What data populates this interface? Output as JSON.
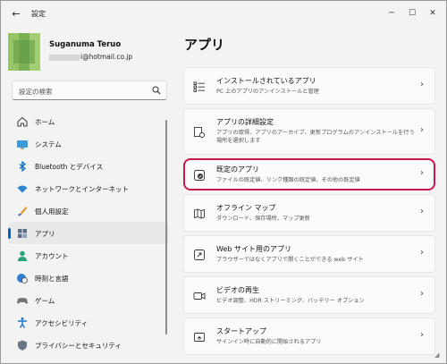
{
  "window": {
    "title": "設定",
    "back_icon": "back-arrow-icon",
    "min_glyph": "─",
    "max_glyph": "☐",
    "close_glyph": "✕"
  },
  "profile": {
    "name": "Suganuma Teruo",
    "email": "i@hotmail.co.jp"
  },
  "search": {
    "placeholder": "設定の検索"
  },
  "sidebar": {
    "items": [
      {
        "label": "ホーム",
        "icon": "home-icon"
      },
      {
        "label": "システム",
        "icon": "system-icon"
      },
      {
        "label": "Bluetooth とデバイス",
        "icon": "bluetooth-icon"
      },
      {
        "label": "ネットワークとインターネット",
        "icon": "wifi-icon"
      },
      {
        "label": "個人用設定",
        "icon": "brush-icon"
      },
      {
        "label": "アプリ",
        "icon": "apps-icon",
        "active": true
      },
      {
        "label": "アカウント",
        "icon": "account-icon"
      },
      {
        "label": "時刻と言語",
        "icon": "time-language-icon"
      },
      {
        "label": "ゲーム",
        "icon": "gamepad-icon"
      },
      {
        "label": "アクセシビリティ",
        "icon": "accessibility-icon"
      },
      {
        "label": "プライバシーとセキュリティ",
        "icon": "shield-icon"
      }
    ]
  },
  "main": {
    "title": "アプリ",
    "cards": [
      {
        "title": "インストールされているアプリ",
        "desc": "PC 上のアプリのアンインストールと管理",
        "icon": "installed-apps-icon"
      },
      {
        "title": "アプリの詳細設定",
        "desc": "アプリの取得、アプリのアーカイブ、更新プログラムのアンインストールを行う場所を選択します",
        "icon": "advanced-app-settings-icon"
      },
      {
        "title": "既定のアプリ",
        "desc": "ファイルの既定値、リンク種類の既定値、その他の既定値",
        "icon": "default-apps-icon",
        "highlight": true
      },
      {
        "title": "オフライン マップ",
        "desc": "ダウンロード、保存場所、マップ更新",
        "icon": "offline-maps-icon"
      },
      {
        "title": "Web サイト用のアプリ",
        "desc": "ブラウザーではなくアプリで開くことができる web サイト",
        "icon": "apps-for-websites-icon"
      },
      {
        "title": "ビデオの再生",
        "desc": "ビデオ調整、HDR ストリーミング、バッテリー オプション",
        "icon": "video-playback-icon"
      },
      {
        "title": "スタートアップ",
        "desc": "サインイン時に自動的に開始されるアプリ",
        "icon": "startup-icon"
      }
    ]
  },
  "colors": {
    "accent": "#005fb8",
    "highlight_border": "#c8174a"
  }
}
